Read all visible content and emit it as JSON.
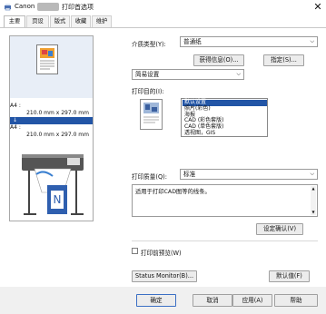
{
  "window": {
    "title_brand": "Canon",
    "title_suffix": "打印首选项",
    "close_glyph": "✕"
  },
  "tabs": [
    {
      "label": "主要"
    },
    {
      "label": "页设置"
    },
    {
      "label": "版式"
    },
    {
      "label": "收藏"
    },
    {
      "label": "维护"
    }
  ],
  "preview": {
    "size_lines": [
      "A4 :",
      "210.0 mm x 297.0 mm",
      "实际尺寸",
      "A4 :",
      "210.0 mm x 297.0 mm"
    ],
    "highlight_index": 2,
    "printer_icon": "large-format-printer-icon"
  },
  "media": {
    "label": "介质类型(Y):",
    "value": "普通纸",
    "get_info_button": "获得信息(O)...",
    "specify_button": "指定(S)..."
  },
  "mode": {
    "value": "简易设置"
  },
  "purpose": {
    "label": "打印目的(I):",
    "items": [
      "默认设置",
      "照片(彩色)",
      "海报",
      "CAD (彩色套版)",
      "CAD (单色套版)",
      "透视图，GIS"
    ],
    "selected_index": 0
  },
  "quality": {
    "label": "打印质量(Q):",
    "value": "标准",
    "description": "适用于打印CAD图等的线条。",
    "confirm_button": "设定确认(V)"
  },
  "preview_before": {
    "label": "打印前预览(W)",
    "checked": false
  },
  "bottom_tools": {
    "status_monitor_button": "Status Monitor(B)...",
    "defaults_button": "默认值(F)"
  },
  "dialog_buttons": {
    "ok": "确定",
    "cancel": "取消",
    "apply": "应用(A)",
    "help": "帮助"
  },
  "colors": {
    "selection": "#2255a6",
    "primary_border": "#3b6fc4"
  }
}
